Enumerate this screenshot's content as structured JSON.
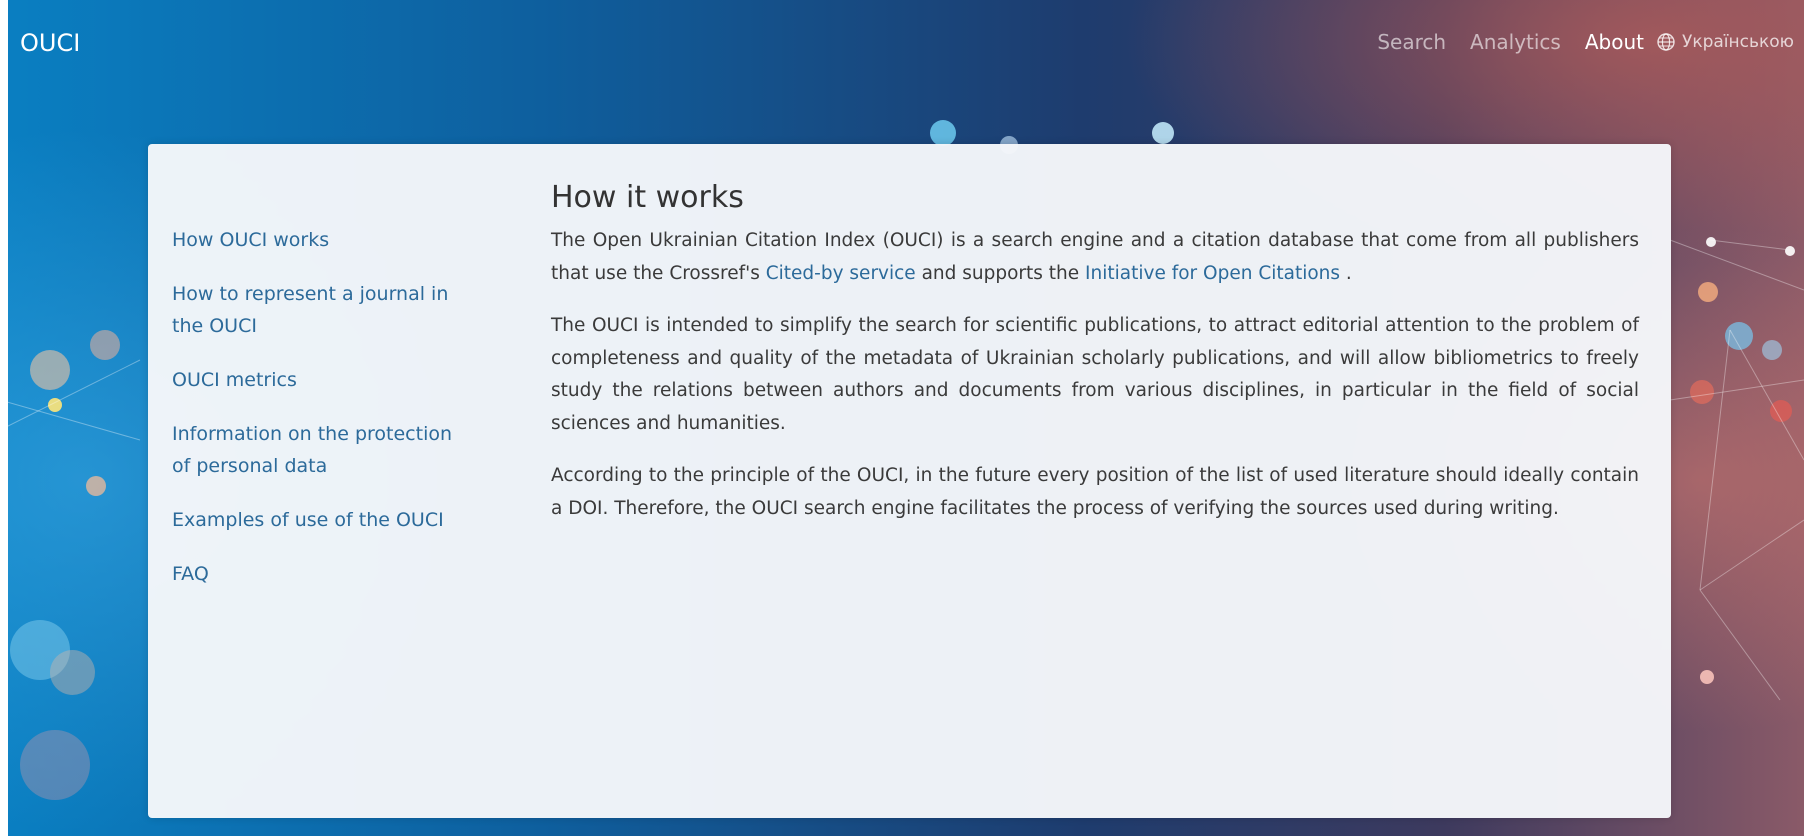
{
  "navbar": {
    "brand": "OUCI",
    "links": [
      {
        "label": "Search"
      },
      {
        "label": "Analytics"
      },
      {
        "label": "About"
      }
    ],
    "language": "Українською",
    "icons": {
      "language": "globe-icon"
    }
  },
  "sidebar": {
    "items": [
      {
        "label": "How OUCI works"
      },
      {
        "label": "How to represent a journal in the OUCI"
      },
      {
        "label": "OUCI metrics"
      },
      {
        "label": "Information on the protection of personal data"
      },
      {
        "label": "Examples of use of the OUCI"
      },
      {
        "label": "FAQ"
      }
    ]
  },
  "main": {
    "title": "How it works",
    "p1": {
      "text_a": "The Open Ukrainian Citation Index (OUCI) is a search engine and a citation database that come from all publishers that use the Crossref's ",
      "link1": "Cited-by service",
      "text_b": " and supports the ",
      "link2": "Initiative for Open Citations",
      "text_c": " ."
    },
    "p2": "The OUCI is intended to simplify the search for scientific publications, to attract editorial attention to the problem of completeness and quality of the metadata of Ukrainian scholarly publications, and will allow bibliometrics to freely study the relations between authors and documents from various disciplines, in particular in the field of social sciences and humanities.",
    "p3": "According to the principle of the OUCI, in the future every position of the list of used literature should ideally contain a DOI. Therefore, the OUCI search engine facilitates the process of verifying the sources used during writing."
  },
  "colors": {
    "link": "#2c6a9a",
    "text": "#3a3a3a",
    "card": "#f5f7fa"
  }
}
